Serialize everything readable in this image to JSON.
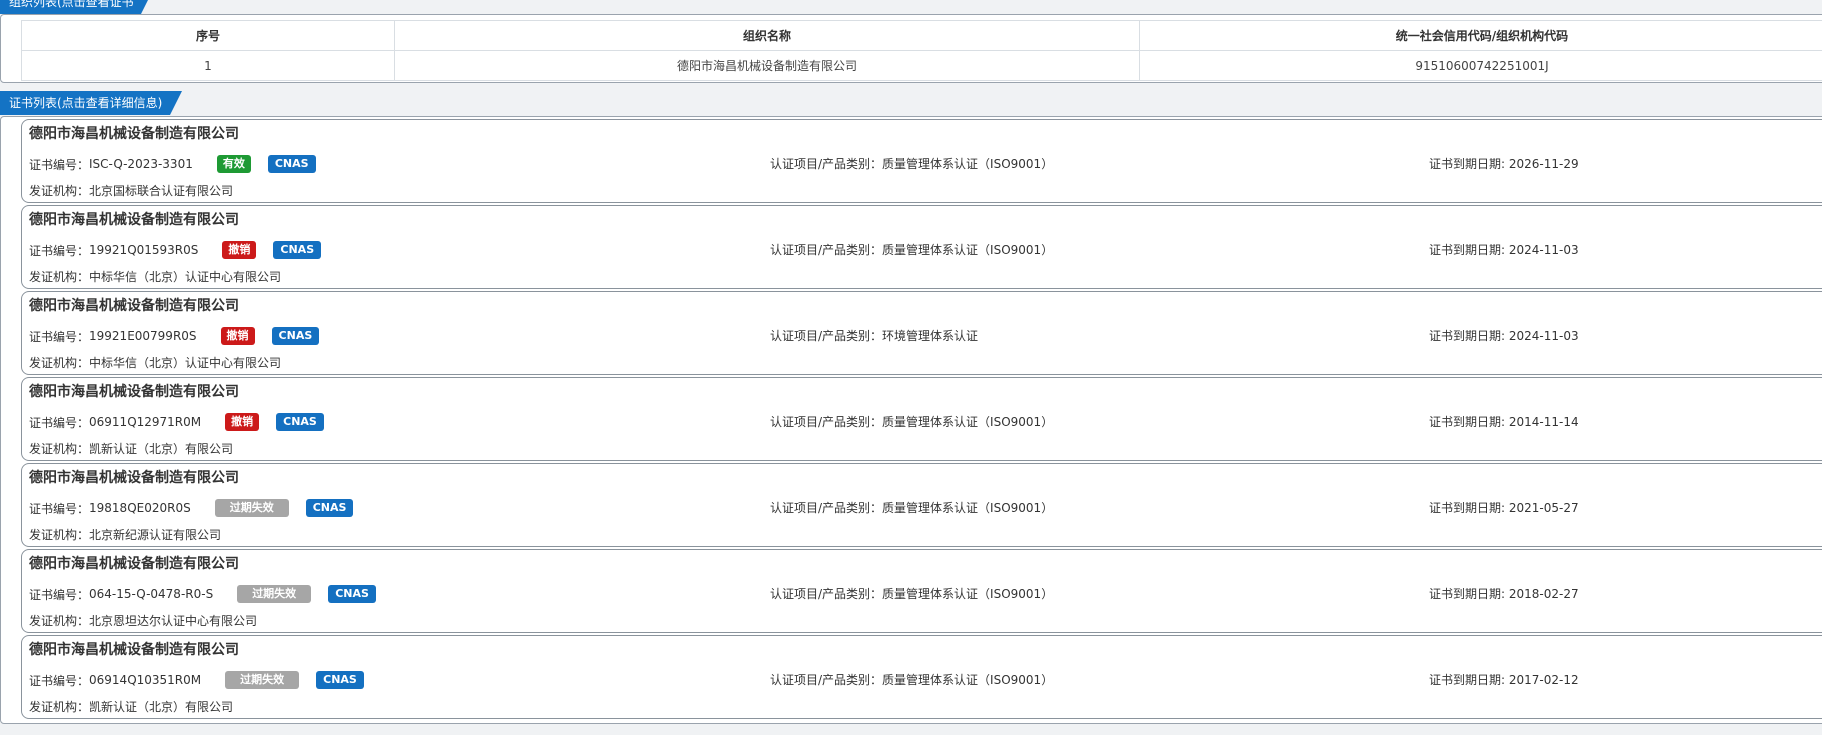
{
  "org_panel": {
    "title": "组织列表(点击查看证书信息)",
    "columns": [
      "序号",
      "组织名称",
      "统一社会信用代码/组织机构代码"
    ],
    "rows": [
      {
        "index": "1",
        "name": "德阳市海昌机械设备制造有限公司",
        "code": "91510600742251001J"
      }
    ]
  },
  "cert_panel": {
    "title": "证书列表(点击查看详细信息)",
    "labels": {
      "number": "证书编号：",
      "project": "认证项目/产品类别：",
      "expire": "证书到期日期: ",
      "issuer": "发证机构："
    },
    "certs": [
      {
        "company": "德阳市海昌机械设备制造有限公司",
        "number": "ISC-Q-2023-3301",
        "status": "有效",
        "status_color": "#1e9a34",
        "cnas": "CNAS",
        "project": "质量管理体系认证（ISO9001）",
        "expire": "2026-11-29",
        "issuer": "北京国标联合认证有限公司"
      },
      {
        "company": "德阳市海昌机械设备制造有限公司",
        "number": "19921Q01593R0S",
        "status": "撤销",
        "status_color": "#cc1a1a",
        "cnas": "CNAS",
        "project": "质量管理体系认证（ISO9001）",
        "expire": "2024-11-03",
        "issuer": "中标华信（北京）认证中心有限公司"
      },
      {
        "company": "德阳市海昌机械设备制造有限公司",
        "number": "19921E00799R0S",
        "status": "撤销",
        "status_color": "#cc1a1a",
        "cnas": "CNAS",
        "project": "环境管理体系认证",
        "expire": "2024-11-03",
        "issuer": "中标华信（北京）认证中心有限公司"
      },
      {
        "company": "德阳市海昌机械设备制造有限公司",
        "number": "06911Q12971R0M",
        "status": "撤销",
        "status_color": "#cc1a1a",
        "cnas": "CNAS",
        "project": "质量管理体系认证（ISO9001）",
        "expire": "2014-11-14",
        "issuer": "凯新认证（北京）有限公司"
      },
      {
        "company": "德阳市海昌机械设备制造有限公司",
        "number": "19818QE020R0S",
        "status": "过期失效",
        "status_color": "#a6a6a6",
        "cnas": "CNAS",
        "project": "质量管理体系认证（ISO9001）",
        "expire": "2021-05-27",
        "issuer": "北京新纪源认证有限公司"
      },
      {
        "company": "德阳市海昌机械设备制造有限公司",
        "number": "064-15-Q-0478-R0-S",
        "status": "过期失效",
        "status_color": "#a6a6a6",
        "cnas": "CNAS",
        "project": "质量管理体系认证（ISO9001）",
        "expire": "2018-02-27",
        "issuer": "北京恩坦达尔认证中心有限公司"
      },
      {
        "company": "德阳市海昌机械设备制造有限公司",
        "number": "06914Q10351R0M",
        "status": "过期失效",
        "status_color": "#a6a6a6",
        "cnas": "CNAS",
        "project": "质量管理体系认证（ISO9001）",
        "expire": "2017-02-12",
        "issuer": "凯新认证（北京）有限公司"
      }
    ]
  }
}
